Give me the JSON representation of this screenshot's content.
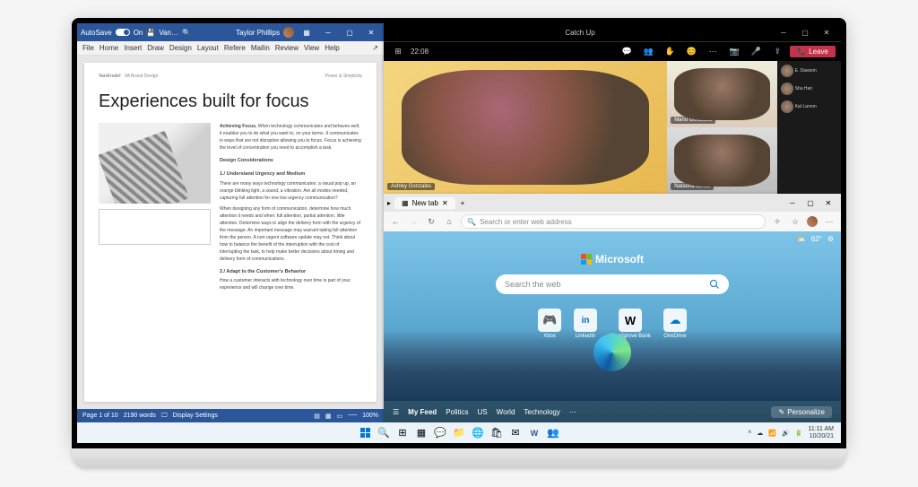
{
  "word": {
    "autosave": "AutoSave",
    "on": "On",
    "doc_short": "Van…",
    "user": "Taylor Phillips",
    "ribbon": [
      "File",
      "Home",
      "Insert",
      "Draw",
      "Design",
      "Layout",
      "Refere",
      "Mailin",
      "Review",
      "View",
      "Help"
    ],
    "page_hdr_left": "VanArsdel",
    "page_hdr_mid": "VA Brand Design",
    "page_hdr_right": "Power & Simplicity",
    "headline": "Experiences built for focus",
    "body_heading1": "Achieving Focus.",
    "body_p1": "When technology communicates and behaves well, it enables you to do what you want to, on your terms. It communicates in ways that are not disruptive allowing you to focus. Focus is achieving the level of concentration you need to accomplish a task.",
    "body_heading2": "Design Considerations",
    "body_heading3": "1./ Understand Urgency and Medium",
    "body_p2": "There are many ways technology communicates: a visual pop up, an orange blinking light, a sound, a vibration. Are all modes needed, capturing full attention for one low urgency communication?",
    "body_p3": "When designing any form of communication, determine how much attention it needs and when: full attention, partial attention, little attention. Determine ways to align the delivery form with the urgency of the message. An important message may warrant taking full attention from the person. A non-urgent software update may not. Think about how to balance the benefit of the interruption with the cost of interrupting the task, to help make better decisions about timing and delivery form of communications.",
    "body_heading4": "2./ Adapt to the Customer's Behavior",
    "body_p4": "How a customer interacts with technology over time is part of your experience and will change over time.",
    "status_page": "Page 1 of 10",
    "status_words": "2190 words",
    "status_display": "Display Settings",
    "zoom": "100%"
  },
  "teams": {
    "title": "Catch Up",
    "time": "22:08",
    "leave": "Leave",
    "main_name": "Ashley Gonzales",
    "p2": "Mario Gonzales",
    "p3": "Natasha Jones",
    "roster": [
      "E. Dawson",
      "Sha Hari",
      "Kat Larson"
    ]
  },
  "edge": {
    "tab": "New tab",
    "url_placeholder": "Search or enter web address",
    "brand": "Microsoft",
    "weather": "62°",
    "search_placeholder": "Search the web",
    "tiles": [
      {
        "label": "Xbox",
        "icon": "🎮",
        "color": "#107c10"
      },
      {
        "label": "LinkedIn",
        "icon": "in",
        "color": "#0a66c2"
      },
      {
        "label": "Woodgrove Bank",
        "icon": "W",
        "color": "#333"
      },
      {
        "label": "OneDrive",
        "icon": "☁",
        "color": "#0078d4"
      }
    ],
    "feed": [
      "My Feed",
      "Politics",
      "US",
      "World",
      "Technology"
    ],
    "personalize": "Personalize"
  },
  "taskbar": {
    "date": "10/20/21",
    "time": "11:11 AM"
  }
}
